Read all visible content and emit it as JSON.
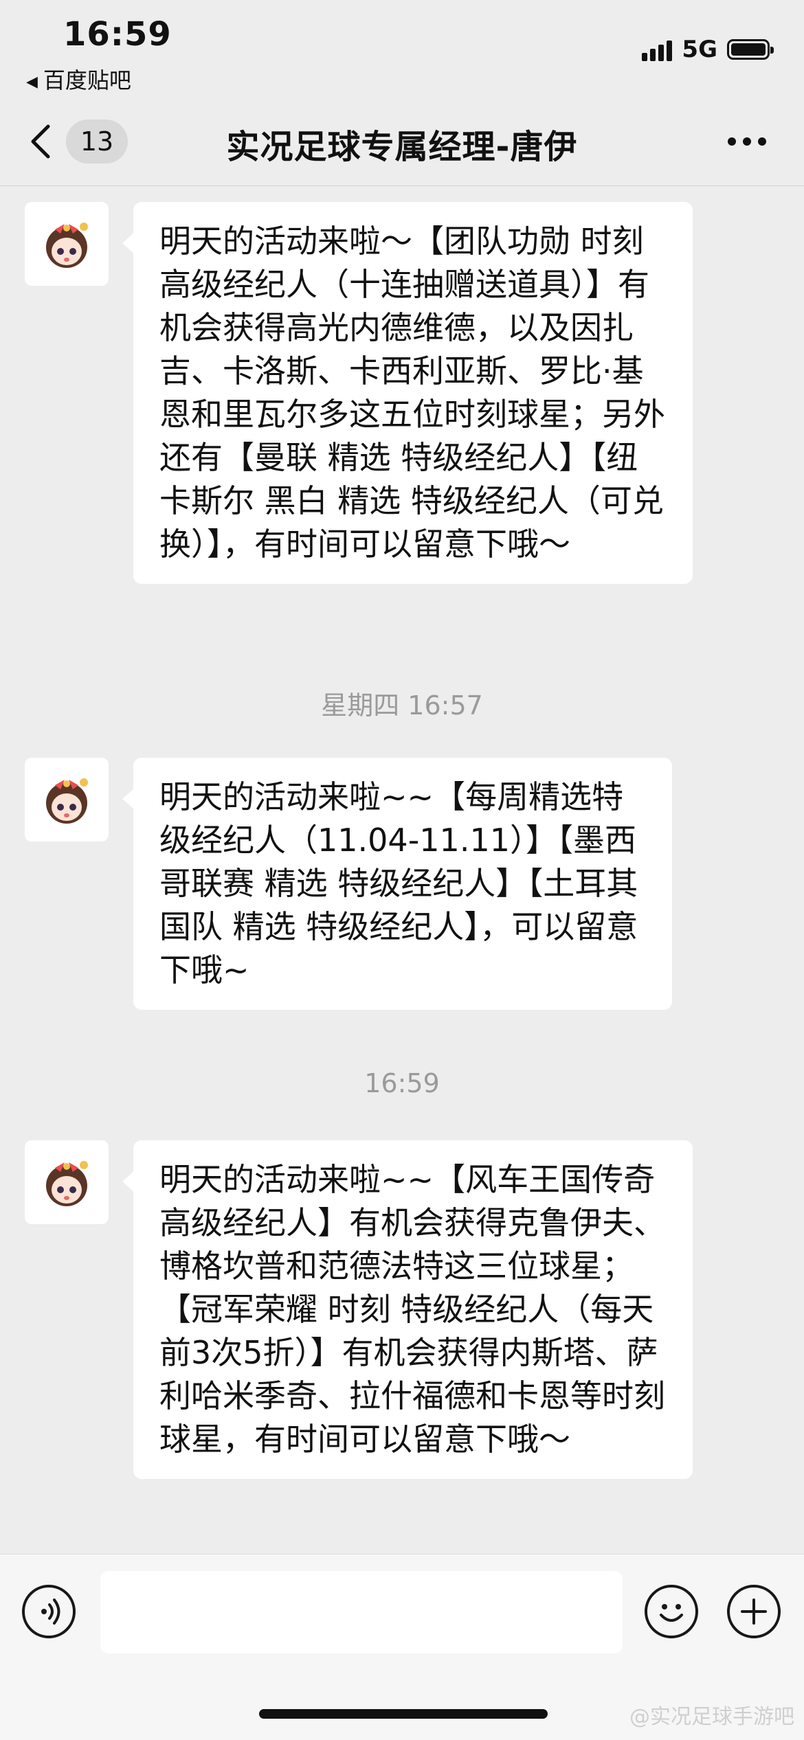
{
  "status_bar": {
    "time": "16:59",
    "back_app": "百度贴吧",
    "network": "5G"
  },
  "nav": {
    "unread_count": "13",
    "title": "实况足球专属经理-唐伊"
  },
  "messages": [
    {
      "sender": "avatar-tang-yi",
      "text": "明天的活动来啦～【团队功勋 时刻 高级经纪人（十连抽赠送道具）】有机会获得高光内德维德，以及因扎吉、卡洛斯、卡西利亚斯、罗比·基恩和里瓦尔多这五位时刻球星；另外还有【曼联 精选 特级经纪人】【纽卡斯尔 黑白 精选 特级经纪人（可兑换）】，有时间可以留意下哦～"
    },
    {
      "timestamp": "星期四 16:57",
      "text": "明天的活动来啦~~【每周精选特级经纪人（11.04-11.11）】【墨西哥联赛 精选 特级经纪人】【土耳其国队 精选 特级经纪人】，可以留意下哦~"
    },
    {
      "timestamp": "16:59",
      "text": "明天的活动来啦~~【风车王国传奇 高级经纪人】有机会获得克鲁伊夫、博格坎普和范德法特这三位球星；【冠军荣耀 时刻 特级经纪人（每天前3次5折）】有机会获得内斯塔、萨利哈米季奇、拉什福德和卡恩等时刻球星，有时间可以留意下哦～"
    }
  ],
  "input_bar": {
    "placeholder": "",
    "voice_icon": "voice-icon",
    "emoji_icon": "emoji-icon",
    "plus_icon": "plus-icon"
  },
  "watermark": "@实况足球手游吧",
  "colors": {
    "background": "#ededed",
    "bubble": "#ffffff",
    "timestamp": "#9a9a9a"
  }
}
